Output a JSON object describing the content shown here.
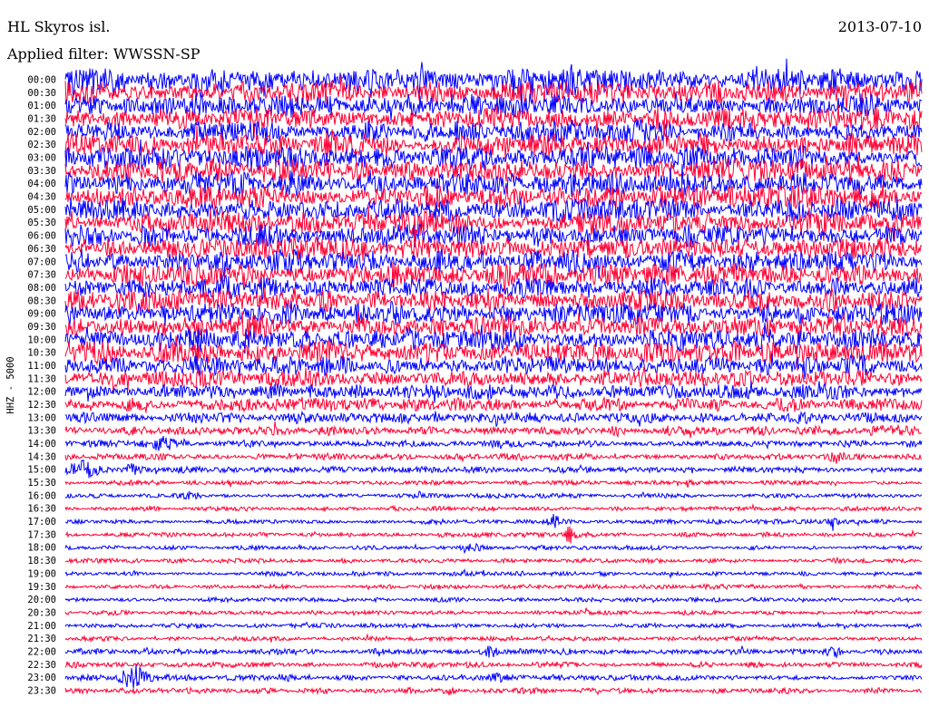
{
  "chart_data": {
    "type": "line",
    "title": "HL Skyros isl.",
    "date": "2013-07-10",
    "filter": "Applied filter: WWSSN-SP",
    "ylabel": "HHZ - 5000",
    "xlabel": "",
    "grid": false,
    "series_colors": [
      "#0000ff",
      "#ff0033"
    ],
    "rows": [
      "00:00",
      "00:30",
      "01:00",
      "01:30",
      "02:00",
      "02:30",
      "03:00",
      "03:30",
      "04:00",
      "04:30",
      "05:00",
      "05:30",
      "06:00",
      "06:30",
      "07:00",
      "07:30",
      "08:00",
      "08:30",
      "09:00",
      "09:30",
      "10:00",
      "10:30",
      "11:00",
      "11:30",
      "12:00",
      "12:30",
      "13:00",
      "13:30",
      "14:00",
      "14:30",
      "15:00",
      "15:30",
      "16:00",
      "16:30",
      "17:00",
      "17:30",
      "18:00",
      "18:30",
      "19:00",
      "19:30",
      "20:00",
      "20:30",
      "21:00",
      "21:30",
      "22:00",
      "22:30",
      "23:00",
      "23:30"
    ]
  }
}
